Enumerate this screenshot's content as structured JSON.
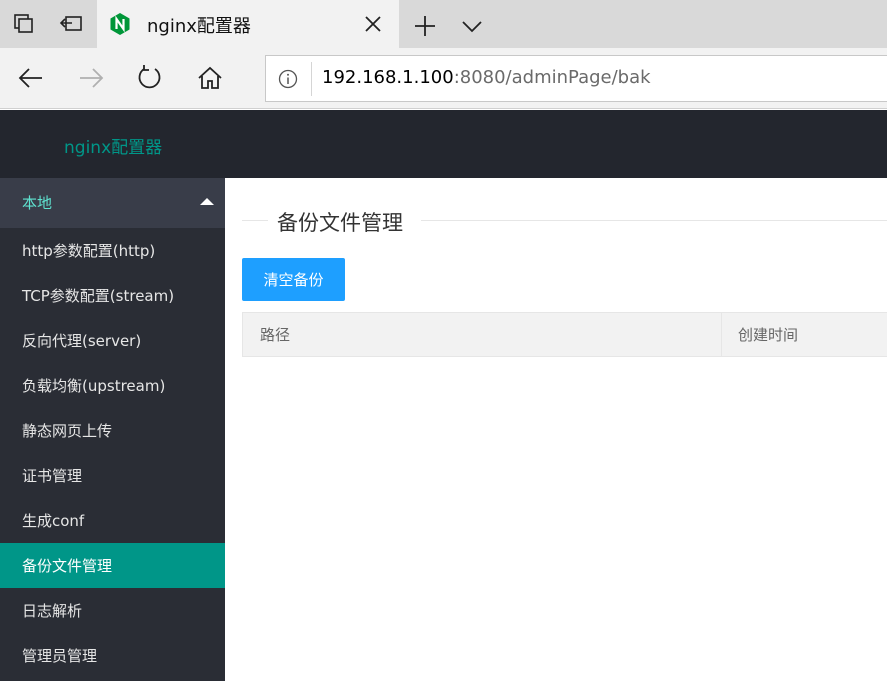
{
  "browser": {
    "tab_title": "nginx配置器",
    "address": {
      "host": "192.168.1.100",
      "rest": ":8080/adminPage/bak"
    }
  },
  "app": {
    "logo": "nginx配置器"
  },
  "sidebar": {
    "group_label": "本地",
    "items": [
      {
        "label": "http参数配置(http)",
        "active": false
      },
      {
        "label": "TCP参数配置(stream)",
        "active": false
      },
      {
        "label": "反向代理(server)",
        "active": false
      },
      {
        "label": "负载均衡(upstream)",
        "active": false
      },
      {
        "label": "静态网页上传",
        "active": false
      },
      {
        "label": "证书管理",
        "active": false
      },
      {
        "label": "生成conf",
        "active": false
      },
      {
        "label": "备份文件管理",
        "active": true
      },
      {
        "label": "日志解析",
        "active": false
      },
      {
        "label": "管理员管理",
        "active": false
      }
    ]
  },
  "main": {
    "title": "备份文件管理",
    "clear_button": "清空备份",
    "table": {
      "columns": [
        "路径",
        "创建时间"
      ]
    }
  },
  "colors": {
    "accent": "#009688",
    "button": "#1e9fff",
    "header_bg": "#23262e",
    "sidebar_bg": "#2a2d35"
  }
}
